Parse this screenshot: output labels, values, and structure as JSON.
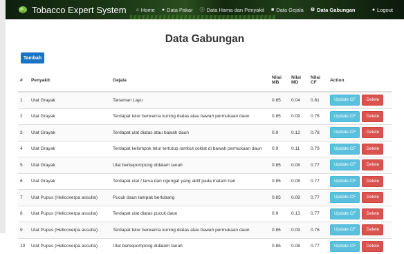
{
  "navbar": {
    "brand": "Tobacco Expert System",
    "items": [
      {
        "label": "Home",
        "icon": "home-icon",
        "glyph": "⌂"
      },
      {
        "label": "Data Pakar",
        "icon": "user-icon",
        "glyph": "●"
      },
      {
        "label": "Data Hama dan Penyakit",
        "icon": "info-icon",
        "glyph": "ⓘ"
      },
      {
        "label": "Data Gejala",
        "icon": "file-icon",
        "glyph": "■"
      },
      {
        "label": "Data Gabungan",
        "icon": "gear-icon",
        "glyph": "⚙"
      }
    ],
    "logout": "Logout"
  },
  "page": {
    "title": "Data Gabungan",
    "add_button": "Tambah"
  },
  "table": {
    "headers": {
      "no": "#",
      "penyakit": "Penyakit",
      "gejala": "Gejala",
      "mb_1": "Nilai",
      "mb_2": "MB",
      "md_1": "Nilai",
      "md_2": "MD",
      "cf_1": "Nilai",
      "cf_2": "CF",
      "action": "Action"
    },
    "update_label": "Update CF",
    "delete_label": "Delete",
    "rows": [
      {
        "no": "1",
        "penyakit": "Ulat Grayak",
        "gejala": "Tanaman Layu",
        "mb": "0.65",
        "md": "0.04",
        "cf": "0.61"
      },
      {
        "no": "2",
        "penyakit": "Ulat Grayak",
        "gejala": "Terdapat telur berwarna kuning diatas atau bawah permukaan daun",
        "mb": "0.85",
        "md": "0.09",
        "cf": "0.76"
      },
      {
        "no": "3",
        "penyakit": "Ulat Grayak",
        "gejala": "Terdapat ulat diatas atau bawah daun",
        "mb": "0.9",
        "md": "0.12",
        "cf": "0.78"
      },
      {
        "no": "4",
        "penyakit": "Ulat Grayak",
        "gejala": "Terdapat kelompok telur tertutup rambut coklat di bawah permukaan daun",
        "mb": "0.9",
        "md": "0.11",
        "cf": "0.79"
      },
      {
        "no": "5",
        "penyakit": "Ulat Grayak",
        "gejala": "Ulat berkepompong didalam tanah",
        "mb": "0.85",
        "md": "0.08",
        "cf": "0.77"
      },
      {
        "no": "6",
        "penyakit": "Ulat Grayak",
        "gejala": "Terdapat ulat / larva dan ngengat yang aktif pada malam hari",
        "mb": "0.85",
        "md": "0.08",
        "cf": "0.77"
      },
      {
        "no": "7",
        "penyakit": "Ulat Pupus (Helicoverpa assulta)",
        "gejala": "Pucuk daun tampak berlubang",
        "mb": "0.85",
        "md": "0.08",
        "cf": "0.77"
      },
      {
        "no": "8",
        "penyakit": "Ulat Pupus (Helicoverpa assulta)",
        "gejala": "Terdapat ulat diatas pucuk daun",
        "mb": "0.9",
        "md": "0.13",
        "cf": "0.77"
      },
      {
        "no": "9",
        "penyakit": "Ulat Pupus (Helicoverpa assulta)",
        "gejala": "Terdapat telur berwarna kuning diatas atau bawah permukaan daun",
        "mb": "0.85",
        "md": "0.09",
        "cf": "0.76"
      },
      {
        "no": "10",
        "penyakit": "Ulat Pupus (Helicoverpa assulta)",
        "gejala": "Ulat berkepompong didalam tanah",
        "mb": "0.85",
        "md": "0.08",
        "cf": "0.77"
      }
    ]
  }
}
